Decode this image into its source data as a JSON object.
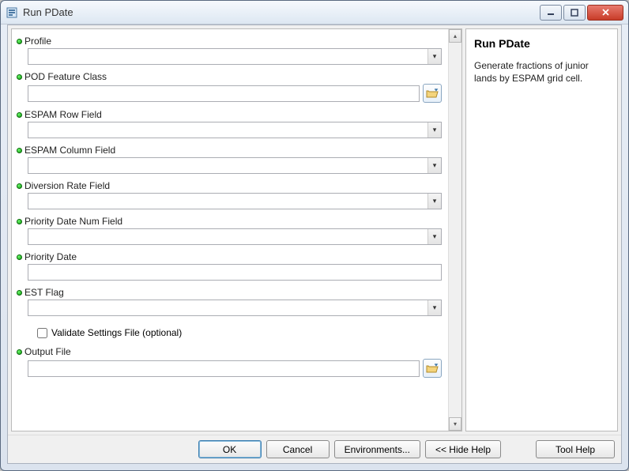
{
  "window": {
    "title": "Run PDate"
  },
  "fields": {
    "profile": {
      "label": "Profile",
      "value": ""
    },
    "pod_feature_class": {
      "label": "POD Feature Class",
      "value": ""
    },
    "espam_row": {
      "label": "ESPAM Row Field",
      "value": ""
    },
    "espam_col": {
      "label": "ESPAM Column Field",
      "value": ""
    },
    "diversion_rate": {
      "label": "Diversion Rate Field",
      "value": ""
    },
    "priority_date_num": {
      "label": "Priority Date Num Field",
      "value": ""
    },
    "priority_date": {
      "label": "Priority Date",
      "value": ""
    },
    "est_flag": {
      "label": "EST Flag",
      "value": ""
    },
    "validate_settings": {
      "label": "Validate Settings File (optional)",
      "checked": false
    },
    "output_file": {
      "label": "Output File",
      "value": ""
    }
  },
  "help": {
    "title": "Run PDate",
    "body": "Generate fractions of junior lands by ESPAM grid cell."
  },
  "buttons": {
    "ok": "OK",
    "cancel": "Cancel",
    "environments": "Environments...",
    "hide_help": "<< Hide Help",
    "tool_help": "Tool Help"
  }
}
